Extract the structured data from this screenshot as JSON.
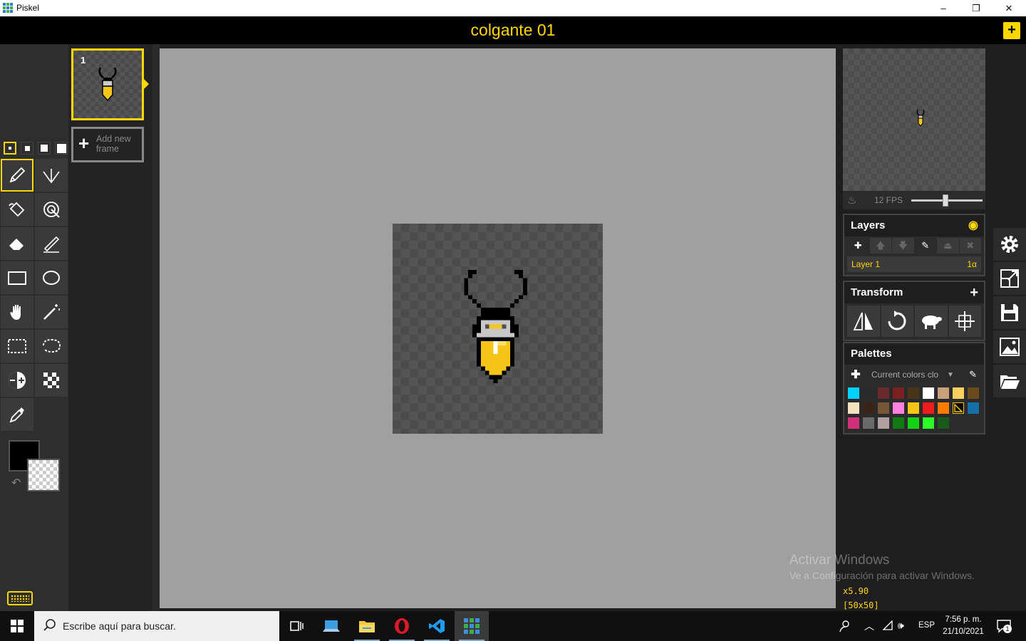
{
  "window": {
    "title": "Piskel",
    "minimize": "–",
    "maximize": "❐",
    "close": "✕"
  },
  "header": {
    "sprite_name": "colgante 01",
    "new_button": "+"
  },
  "tools": {
    "pen_sizes": [
      1,
      2,
      3,
      4
    ],
    "active_pen_size": 1,
    "items": [
      {
        "name": "pen-tool",
        "icon": "pencil-icon",
        "active": true
      },
      {
        "name": "vertical-mirror-pen-tool",
        "icon": "mirror-pen-icon"
      },
      {
        "name": "paint-bucket-tool",
        "icon": "bucket-icon"
      },
      {
        "name": "paint-same-color-tool",
        "icon": "magic-bucket-icon"
      },
      {
        "name": "eraser-tool",
        "icon": "eraser-icon"
      },
      {
        "name": "stroke-tool",
        "icon": "line-icon"
      },
      {
        "name": "rectangle-tool",
        "icon": "rectangle-icon"
      },
      {
        "name": "circle-tool",
        "icon": "circle-icon"
      },
      {
        "name": "move-tool",
        "icon": "hand-icon"
      },
      {
        "name": "shape-selection-tool",
        "icon": "magic-wand-icon"
      },
      {
        "name": "rectangle-selection-tool",
        "icon": "rect-select-icon"
      },
      {
        "name": "lasso-selection-tool",
        "icon": "lasso-icon"
      },
      {
        "name": "lighten-tool",
        "icon": "lighten-icon"
      },
      {
        "name": "dithering-tool",
        "icon": "dither-icon"
      },
      {
        "name": "color-picker-tool",
        "icon": "eyedropper-icon"
      }
    ],
    "primary_color": "#000000",
    "secondary_color": "transparent"
  },
  "frames": {
    "items": [
      {
        "number": "1"
      }
    ],
    "add_new_frame": "Add new frame"
  },
  "preview": {
    "fps_label": "12 FPS",
    "fps": 12,
    "fps_slider_fraction": 0.48
  },
  "layers": {
    "title": "Layers",
    "items": [
      {
        "name": "Layer 1",
        "alpha": "1α"
      }
    ]
  },
  "transform": {
    "title": "Transform",
    "tools": [
      "flip-icon",
      "rotate-icon",
      "clone-sheep-icon",
      "center-icon"
    ]
  },
  "palettes": {
    "title": "Palettes",
    "current": "Current colors clo",
    "colors": [
      "#00d2ff",
      "#2a2a2a",
      "#6b2b2b",
      "#7a2020",
      "#4a3418",
      "#ffffff",
      "#c8a07a",
      "#f7d060",
      "#6b4a1e",
      "#f5e0c0",
      "#3a2418",
      "#7a5638",
      "#ff80e0",
      "#f5c518",
      "#ee1c1c",
      "#ff7b00",
      "#1e90cc",
      "#1570a8",
      "#d0307a",
      "#6a6a6a",
      "#b0a0a0",
      "#127a12",
      "#14d214",
      "#2aff2a",
      "#1a5a1a"
    ],
    "special_swatch_index": 16
  },
  "status": {
    "zoom": "x5.90",
    "size": "[50x50]"
  },
  "watermark": {
    "line1": "Activar Windows",
    "line2": "Ve a Configuración para activar Windows."
  },
  "taskbar": {
    "search_placeholder": "Escribe aquí para buscar.",
    "language": "ESP",
    "time": "7:56 p. m.",
    "date": "21/10/2021",
    "notification_count": "1"
  }
}
